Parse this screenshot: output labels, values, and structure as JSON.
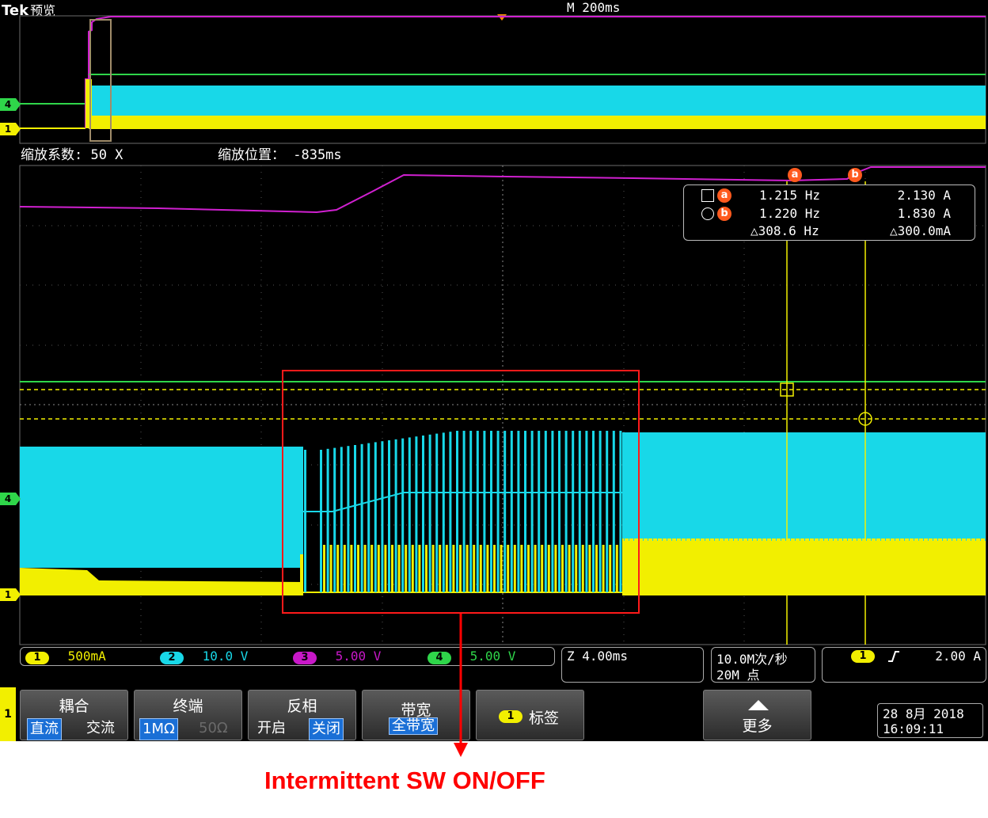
{
  "header": {
    "brand": "Tek",
    "mode": "预览",
    "timebase": "M 200ms"
  },
  "zoom": {
    "factor": "缩放系数: 50 X",
    "position": "缩放位置： -835ms"
  },
  "channel_markers": {
    "ch4": "4",
    "ch1": "1"
  },
  "cursor_readout": {
    "row_a": {
      "badge": "a",
      "freq": "1.215 Hz",
      "value": "2.130 A"
    },
    "row_b": {
      "badge": "b",
      "freq": "1.220 Hz",
      "value": "1.830 A"
    },
    "delta": {
      "freq": "△308.6 Hz",
      "value": "△300.0mA"
    }
  },
  "cursor_badges": {
    "a": "a",
    "b": "b"
  },
  "channels": [
    {
      "num": "1",
      "scale": "500mA",
      "color": "#f2ef00"
    },
    {
      "num": "2",
      "scale": "10.0 V",
      "color": "#18d8e8"
    },
    {
      "num": "3",
      "scale": "5.00 V",
      "color": "#c818c8"
    },
    {
      "num": "4",
      "scale": "5.00 V",
      "color": "#2fd64a"
    }
  ],
  "zoom_time": "Z 4.00ms",
  "acquisition": {
    "rate": "10.0M次/秒",
    "points": "20M 点"
  },
  "trigger": {
    "source": "1",
    "slope_icon": "rising-edge-icon",
    "level": "2.00 A"
  },
  "menu": {
    "channel": "1",
    "coupling": {
      "label": "耦合",
      "options": [
        "直流",
        "交流"
      ],
      "selected": "直流"
    },
    "termination": {
      "label": "终端",
      "options": [
        "1MΩ",
        "50Ω"
      ],
      "selected": "1MΩ"
    },
    "invert": {
      "label": "反相",
      "options": [
        "开启",
        "关闭"
      ],
      "selected": "关闭"
    },
    "bandwidth": {
      "label": "带宽",
      "value": "全带宽"
    },
    "label_btn": {
      "badge": "1",
      "text": "标签"
    },
    "more": {
      "text": "更多"
    }
  },
  "datetime": {
    "date": "28 8月  2018",
    "time": "16:09:11"
  },
  "annotation": {
    "text": "Intermittent  SW ON/OFF",
    "color": "#ff0000"
  }
}
